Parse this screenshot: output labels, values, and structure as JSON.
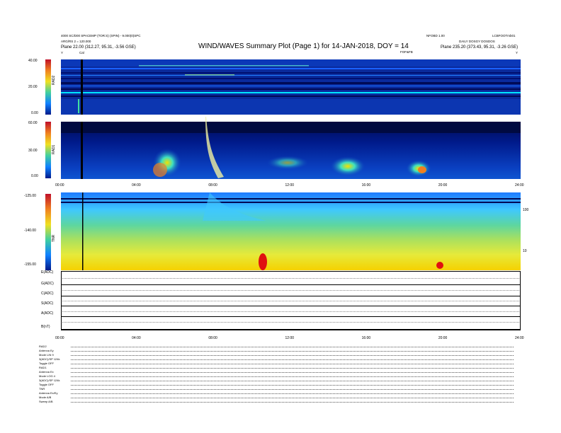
{
  "header": {
    "left_line1": "4000 SC/D00 SPACEMP (TOR:S) (SPIN) - 9.000(0)SPC",
    "left_line2": "ARG/RS 2 = 120.000",
    "left_line3": "Plane  22.00 (312.27, 95.31, -3.56 GSE)",
    "right_top_a": "NFOBD 1.00",
    "right_top_b": "LCBFOOTmb01",
    "right_line2": "DAILY  DOSGY DOSDOS",
    "right_line3": "Plane  235.20 (373.43, 95.31, -3.26 GSE)",
    "title": "WIND/WAVES Summary Plot (Page 1) for 14-JAN-2018, DOY = 14",
    "marker_cal": "Cal",
    "marker_fx": "FOF&FB",
    "marker_y_left": "Y",
    "marker_y_right": "Y"
  },
  "chart_data": [
    {
      "type": "heatmap",
      "name": "RAD2",
      "ylabel": "RAD2",
      "y_ticks": [
        "40.00",
        "20.00",
        "0.00"
      ],
      "ylim": [
        0,
        40
      ],
      "x_range_hours": [
        0,
        24
      ]
    },
    {
      "type": "heatmap",
      "name": "RAD1",
      "ylabel": "RAD1",
      "y_ticks": [
        "60.00",
        "30.00",
        "0.00"
      ],
      "ylim": [
        0,
        60
      ],
      "x_ticks": [
        "00:00",
        "04:00",
        "08:00",
        "12:00",
        "16:00",
        "20:00",
        "24:00"
      ],
      "x_range_hours": [
        0,
        24
      ],
      "events": [
        {
          "type": "type III burst",
          "time_hours": 7.6
        },
        {
          "type": "noise patches",
          "time_range_hours": [
            5,
            6.5
          ]
        },
        {
          "type": "noise patches",
          "time_range_hours": [
            14.5,
            16.5
          ]
        },
        {
          "type": "noise patches",
          "time_range_hours": [
            17.5,
            19.5
          ]
        }
      ]
    },
    {
      "type": "heatmap",
      "name": "TNR",
      "ylabel": "TNR",
      "y_ticks": [
        "-125.00",
        "-140.00",
        "-155.00"
      ],
      "ylim": [
        -155,
        -125
      ],
      "right_ticks": [
        "100",
        "10"
      ],
      "x_range_hours": [
        0,
        24
      ]
    },
    {
      "type": "line",
      "name": "Housekeeping",
      "series": [
        {
          "name": "E(ADC)"
        },
        {
          "name": "G(ADC)"
        },
        {
          "name": "C(ADC)"
        },
        {
          "name": "S(ADC)"
        },
        {
          "name": "A(ADC)"
        },
        {
          "name": "B(nT)"
        }
      ],
      "x_ticks": [
        "00:00",
        "04:00",
        "08:00",
        "12:00",
        "16:00",
        "20:00",
        "24:00"
      ]
    }
  ],
  "footer": {
    "rad2": [
      "RAD2",
      "Antenna  Ey",
      "Mode  LIN 9",
      "3(ADC)/SP  124k",
      "Toggle  OFF"
    ],
    "rad1": [
      "RAD1",
      "Antenna  Ex",
      "Mode  LOG 4",
      "3(ADC)/SP  124k",
      "Toggle  OFF"
    ],
    "tnr": [
      "TNR",
      "Antenna  Ex/Ey",
      "Mode  A/B",
      "Sweep  A/B"
    ]
  },
  "colors": {
    "rad_bg": "#0a2a9c",
    "rad_bg_dark": "#001070",
    "band_line": "#00e5ff",
    "tnr_top": "#1e7bff",
    "tnr_mid": "#5dd6a0",
    "tnr_low": "#d6e84a",
    "tnr_bottom": "#f5d100",
    "burst_red": "#e01010"
  }
}
